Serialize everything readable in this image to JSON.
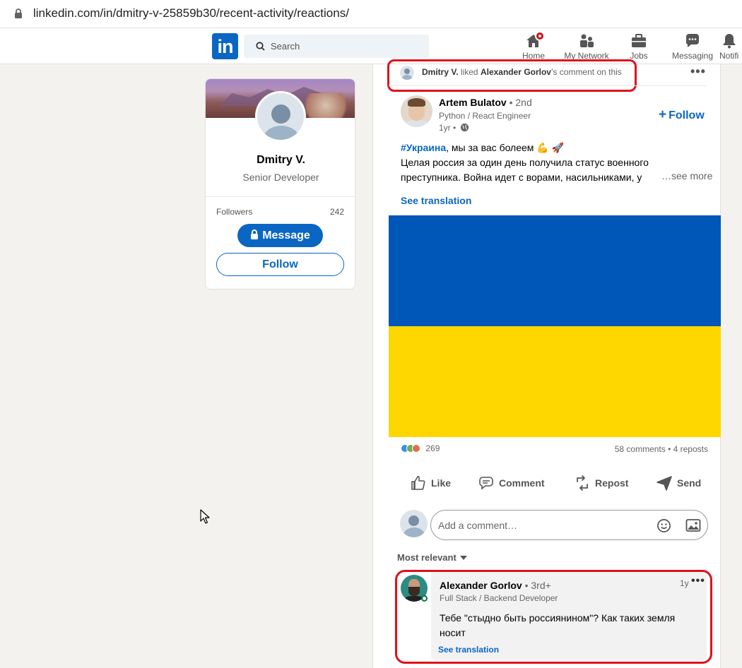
{
  "browser": {
    "url": "linkedin.com/in/dmitry-v-25859b30/recent-activity/reactions/"
  },
  "nav": {
    "logo": "in",
    "search_placeholder": "Search",
    "items": [
      {
        "label": "Home",
        "icon": "home-icon"
      },
      {
        "label": "My Network",
        "icon": "network-icon"
      },
      {
        "label": "Jobs",
        "icon": "briefcase-icon"
      },
      {
        "label": "Messaging",
        "icon": "messaging-icon"
      },
      {
        "label": "Notifi",
        "icon": "bell-icon"
      }
    ]
  },
  "profile": {
    "name": "Dmitry V.",
    "title": "Senior Developer",
    "followers_label": "Followers",
    "followers_count": "242",
    "message_label": "Message",
    "follow_label": "Follow"
  },
  "activity": {
    "actor": "Dmitry V.",
    "verb": " liked ",
    "target": "Alexander Gorlov",
    "suffix": "’s comment on this"
  },
  "post": {
    "author": "Artem Bulatov",
    "degree": "• 2nd",
    "author_title": "Python / React Engineer",
    "time": "1yr •",
    "follow_label": "Follow",
    "hashtag": "#Украина",
    "text_line1_rest": ", мы за вас болеем 💪 🚀",
    "text_line2": "Целая россия за один день получила статус военного",
    "text_line3": "преступника. Война идет с ворами, насильниками, у",
    "see_more": "…see more",
    "see_translation": "See translation",
    "flag_colors": {
      "top": "#0057b8",
      "bottom": "#ffd700"
    },
    "reaction_count": "269",
    "comments_reposts": "58 comments • 4 reposts"
  },
  "actions": [
    {
      "label": "Like",
      "icon": "like-icon"
    },
    {
      "label": "Comment",
      "icon": "comment-icon"
    },
    {
      "label": "Repost",
      "icon": "repost-icon"
    },
    {
      "label": "Send",
      "icon": "send-icon"
    }
  ],
  "comment_input": {
    "placeholder": "Add a comment…"
  },
  "sort": {
    "label": "Most relevant"
  },
  "comment": {
    "author": "Alexander Gorlov",
    "degree": "• 3rd+",
    "title": "Full Stack / Backend Developer",
    "time": "1y",
    "text": "Тебе \"стыдно быть россиянином\"? Как таких земля носит",
    "see_translation": "See translation"
  },
  "colors": {
    "accent": "#0a66c2",
    "highlight": "#e0111b"
  }
}
